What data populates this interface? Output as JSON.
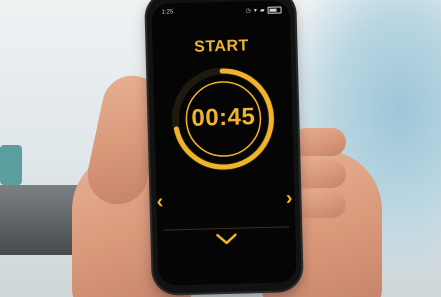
{
  "screen": {
    "status_time": "1:25",
    "start_label": "START",
    "timer": "00:45",
    "ring_progress": 0.72
  },
  "colors": {
    "accent": "#f0b32a",
    "screen_bg": "#050505"
  },
  "icons": {
    "prev": "chevron-left-icon",
    "next": "chevron-right-icon",
    "down": "chevron-down-icon"
  }
}
